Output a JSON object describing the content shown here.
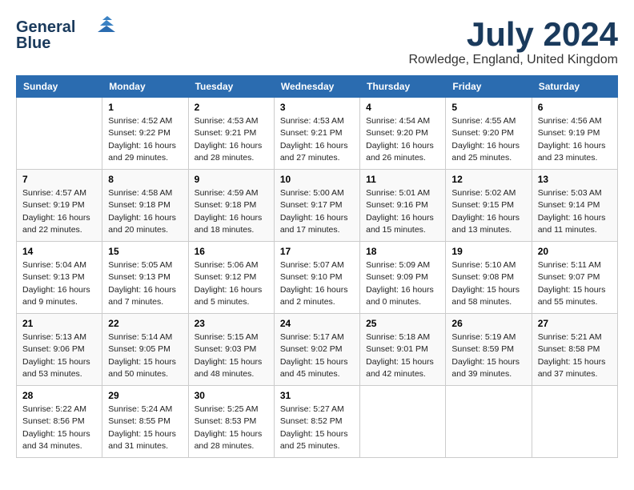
{
  "header": {
    "logo_line1": "General",
    "logo_line2": "Blue",
    "month": "July 2024",
    "location": "Rowledge, England, United Kingdom"
  },
  "days_of_week": [
    "Sunday",
    "Monday",
    "Tuesday",
    "Wednesday",
    "Thursday",
    "Friday",
    "Saturday"
  ],
  "weeks": [
    [
      {
        "day": "",
        "content": ""
      },
      {
        "day": "1",
        "content": "Sunrise: 4:52 AM\nSunset: 9:22 PM\nDaylight: 16 hours\nand 29 minutes."
      },
      {
        "day": "2",
        "content": "Sunrise: 4:53 AM\nSunset: 9:21 PM\nDaylight: 16 hours\nand 28 minutes."
      },
      {
        "day": "3",
        "content": "Sunrise: 4:53 AM\nSunset: 9:21 PM\nDaylight: 16 hours\nand 27 minutes."
      },
      {
        "day": "4",
        "content": "Sunrise: 4:54 AM\nSunset: 9:20 PM\nDaylight: 16 hours\nand 26 minutes."
      },
      {
        "day": "5",
        "content": "Sunrise: 4:55 AM\nSunset: 9:20 PM\nDaylight: 16 hours\nand 25 minutes."
      },
      {
        "day": "6",
        "content": "Sunrise: 4:56 AM\nSunset: 9:19 PM\nDaylight: 16 hours\nand 23 minutes."
      }
    ],
    [
      {
        "day": "7",
        "content": "Sunrise: 4:57 AM\nSunset: 9:19 PM\nDaylight: 16 hours\nand 22 minutes."
      },
      {
        "day": "8",
        "content": "Sunrise: 4:58 AM\nSunset: 9:18 PM\nDaylight: 16 hours\nand 20 minutes."
      },
      {
        "day": "9",
        "content": "Sunrise: 4:59 AM\nSunset: 9:18 PM\nDaylight: 16 hours\nand 18 minutes."
      },
      {
        "day": "10",
        "content": "Sunrise: 5:00 AM\nSunset: 9:17 PM\nDaylight: 16 hours\nand 17 minutes."
      },
      {
        "day": "11",
        "content": "Sunrise: 5:01 AM\nSunset: 9:16 PM\nDaylight: 16 hours\nand 15 minutes."
      },
      {
        "day": "12",
        "content": "Sunrise: 5:02 AM\nSunset: 9:15 PM\nDaylight: 16 hours\nand 13 minutes."
      },
      {
        "day": "13",
        "content": "Sunrise: 5:03 AM\nSunset: 9:14 PM\nDaylight: 16 hours\nand 11 minutes."
      }
    ],
    [
      {
        "day": "14",
        "content": "Sunrise: 5:04 AM\nSunset: 9:13 PM\nDaylight: 16 hours\nand 9 minutes."
      },
      {
        "day": "15",
        "content": "Sunrise: 5:05 AM\nSunset: 9:13 PM\nDaylight: 16 hours\nand 7 minutes."
      },
      {
        "day": "16",
        "content": "Sunrise: 5:06 AM\nSunset: 9:12 PM\nDaylight: 16 hours\nand 5 minutes."
      },
      {
        "day": "17",
        "content": "Sunrise: 5:07 AM\nSunset: 9:10 PM\nDaylight: 16 hours\nand 2 minutes."
      },
      {
        "day": "18",
        "content": "Sunrise: 5:09 AM\nSunset: 9:09 PM\nDaylight: 16 hours\nand 0 minutes."
      },
      {
        "day": "19",
        "content": "Sunrise: 5:10 AM\nSunset: 9:08 PM\nDaylight: 15 hours\nand 58 minutes."
      },
      {
        "day": "20",
        "content": "Sunrise: 5:11 AM\nSunset: 9:07 PM\nDaylight: 15 hours\nand 55 minutes."
      }
    ],
    [
      {
        "day": "21",
        "content": "Sunrise: 5:13 AM\nSunset: 9:06 PM\nDaylight: 15 hours\nand 53 minutes."
      },
      {
        "day": "22",
        "content": "Sunrise: 5:14 AM\nSunset: 9:05 PM\nDaylight: 15 hours\nand 50 minutes."
      },
      {
        "day": "23",
        "content": "Sunrise: 5:15 AM\nSunset: 9:03 PM\nDaylight: 15 hours\nand 48 minutes."
      },
      {
        "day": "24",
        "content": "Sunrise: 5:17 AM\nSunset: 9:02 PM\nDaylight: 15 hours\nand 45 minutes."
      },
      {
        "day": "25",
        "content": "Sunrise: 5:18 AM\nSunset: 9:01 PM\nDaylight: 15 hours\nand 42 minutes."
      },
      {
        "day": "26",
        "content": "Sunrise: 5:19 AM\nSunset: 8:59 PM\nDaylight: 15 hours\nand 39 minutes."
      },
      {
        "day": "27",
        "content": "Sunrise: 5:21 AM\nSunset: 8:58 PM\nDaylight: 15 hours\nand 37 minutes."
      }
    ],
    [
      {
        "day": "28",
        "content": "Sunrise: 5:22 AM\nSunset: 8:56 PM\nDaylight: 15 hours\nand 34 minutes."
      },
      {
        "day": "29",
        "content": "Sunrise: 5:24 AM\nSunset: 8:55 PM\nDaylight: 15 hours\nand 31 minutes."
      },
      {
        "day": "30",
        "content": "Sunrise: 5:25 AM\nSunset: 8:53 PM\nDaylight: 15 hours\nand 28 minutes."
      },
      {
        "day": "31",
        "content": "Sunrise: 5:27 AM\nSunset: 8:52 PM\nDaylight: 15 hours\nand 25 minutes."
      },
      {
        "day": "",
        "content": ""
      },
      {
        "day": "",
        "content": ""
      },
      {
        "day": "",
        "content": ""
      }
    ]
  ]
}
